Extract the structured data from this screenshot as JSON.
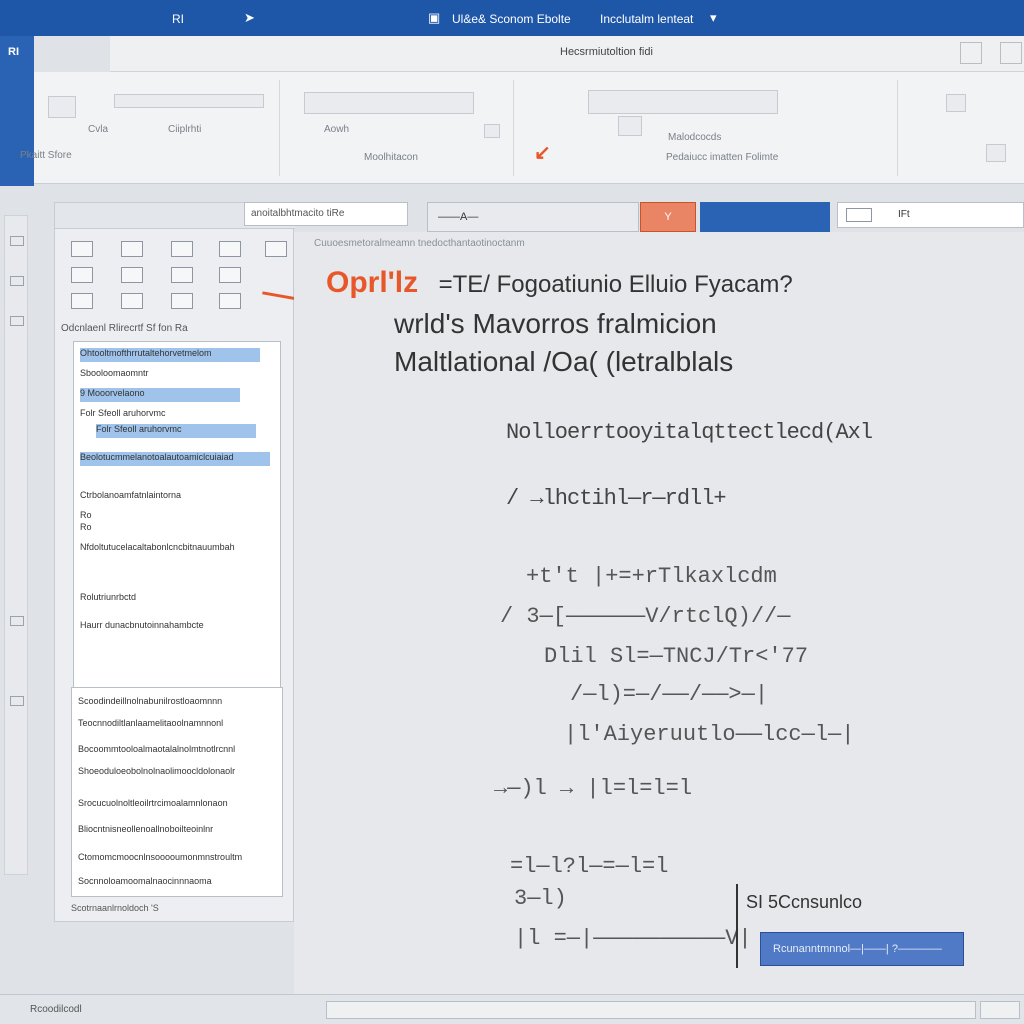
{
  "titlebar": {
    "left_label": "RI",
    "center_label": "Ul&e& Sconom Ebolte",
    "right_label": "Incclutalm lenteat"
  },
  "leftstrip": {
    "label": "RI"
  },
  "qat": {
    "doc_title": "Hecsrmiutoltion fidi"
  },
  "ribbon": {
    "labels": [
      "Cvla",
      "Ciiplrhti",
      "Pkaitt Sfore",
      "Aowh",
      "Moolhitacon",
      "Malodcocds",
      "Pedaiucc imatten Folimte"
    ]
  },
  "nav": {
    "search_text": "anoitalbhtmacito tiRe",
    "heading": "Odcnlaenl Rlirecrtf Sf fon Ra",
    "rows": [
      "Ohtooltmofthrrutaltehorvetmelom",
      "Sbooloomaomntr",
      "9 Mooorvelaono",
      "Folr Sfeoll aruhorvmc",
      "Beolotucmmelanotoalautoamiclcuiaiad",
      "Ctrbolanoamfatnlaintorna",
      "Ro",
      "Ro",
      "Nfdoltutucelacaltabonlcncbitnauumbah",
      "Rolutriunrbctd",
      "Haurr dunacbnutoinnahambcte"
    ],
    "rows2": [
      "Scoodindeillnolnabunilrostloaomnnn",
      "Teocnnodiltlanlaamelitaoolnamnnonl",
      "Bocoommtooloalmaotalalnolmtnotlrcnnl",
      "Shoeoduloeobolnolnaolimoocldolonaolr",
      "Srocucuolnoltleoilrtrcimoalamnlonaon",
      "Bliocntnisneollenoallnoboilteoinlnr",
      "Ctomomcmoocnlnsooooumonmnstroultm",
      "Socnnoloamoomalnaocinnnaoma"
    ],
    "footer": "Scotrnaanlrnoldoch    'S"
  },
  "toolbar": {
    "center_label": "——A—",
    "orange_label": "Y",
    "box_label": "IFt"
  },
  "document": {
    "ruler": "Cuuoesmetoralmeamn    tnedocthantaotinoctanm",
    "title_orange": "Oprl'lz",
    "title_rest": "=TE/ Fogoatiunio Elluio Fyacam?",
    "line2": "wrld's Mavorros fralmicion",
    "line3": "Maltlational /Oa( (letralblals",
    "line4": "Nolloerrtooyitalqttectlecd(Axl",
    "line5": "/  →lhctihl—r—rdll+",
    "eq1": "+t't  |+=+rTlkaxlcdm",
    "eq2": "/ 3—[——————V/rtclQ)//—",
    "eq3": "Dlil  Sl=—TNCJ/Tr<'77",
    "eq4": "/—l)=—/——/——>—|",
    "eq5": "|l'Aiyeruutlo——lcc—l—|",
    "eq6": "→—)l  → |l=l=l=l",
    "eq7": "=l—l?l—=—l=l",
    "eq8": "3—l)",
    "eq9": "|l  =—|——————————V|",
    "side_label": "SI  5Ccnsunlco",
    "blue_bar": "Rcunanntmnnol—|——|  ?————"
  },
  "statusbar": {
    "left": "Rcoodilcodl",
    "right": ""
  },
  "colors": {
    "title_blue": "#1e56a8",
    "accent_orange": "#e8572a",
    "blue_bar": "#5079c6"
  }
}
